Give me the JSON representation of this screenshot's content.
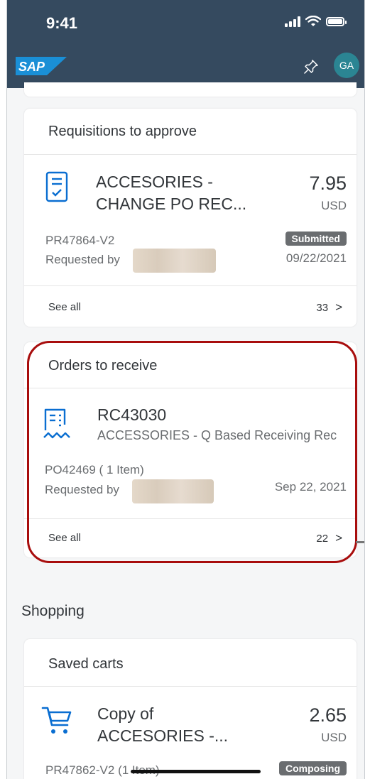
{
  "status_bar": {
    "time": "9:41"
  },
  "app_bar": {
    "logo_text": "SAP",
    "avatar_initials": "GA"
  },
  "requisitions": {
    "title": "Requisitions to approve",
    "item": {
      "title_line1": "ACCESORIES -",
      "title_line2": "CHANGE PO REC...",
      "amount": "7.95",
      "currency": "USD",
      "id": "PR47864-V2",
      "requested_by": "Requested by",
      "status": "Submitted",
      "date": "09/22/2021"
    },
    "see_all": "See all",
    "count": "33"
  },
  "orders": {
    "title": "Orders to receive",
    "item": {
      "id": "RC43030",
      "description": "ACCESSORIES - Q Based Receiving Rec",
      "po": "PO42469 ( 1 Item)",
      "requested_by": "Requested by",
      "date": "Sep 22, 2021"
    },
    "see_all": "See all",
    "count": "22"
  },
  "shopping": {
    "section_title": "Shopping",
    "saved_carts": {
      "title": "Saved carts",
      "item": {
        "title_line1": "Copy of",
        "title_line2": "ACCESORIES -...",
        "amount": "2.65",
        "currency": "USD",
        "id": "PR47862-V2 (1 Item)",
        "status": "Composing"
      }
    }
  },
  "colors": {
    "header": "#354a5f",
    "accent_icon": "#0a6ed1",
    "highlight": "#a80d0d",
    "avatar": "#2b8593"
  },
  "icons": [
    "pin-icon",
    "approval-document-icon",
    "receipt-icon",
    "cart-icon",
    "chevron-right-icon"
  ]
}
